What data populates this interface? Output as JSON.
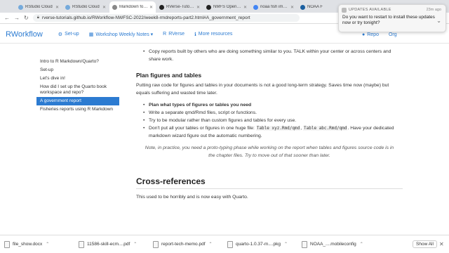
{
  "browser": {
    "tabs": [
      {
        "label": "RStudio Cloud",
        "color": "#75aadb",
        "active": false
      },
      {
        "label": "RStudio Cloud",
        "color": "#75aadb",
        "active": false
      },
      {
        "label": "Markdown for R",
        "color": "#888888",
        "active": true
      },
      {
        "label": "RVerse-Tutorials/C",
        "color": "#222222",
        "active": false
      },
      {
        "label": "NMFS Open Science",
        "color": "#222222",
        "active": false
      },
      {
        "label": "noaa fish image - G",
        "color": "#4285f4",
        "active": false
      },
      {
        "label": "NOAA F",
        "color": "#1a5fa0",
        "active": false
      }
    ],
    "url": "rverse-tutorials.github.io/RWorkflow-NWFSC-2022/week8-rmdreports-part2.html#A_government_report"
  },
  "notification": {
    "title": "UPDATES AVAILABLE",
    "time": "23m ago",
    "body": "Do you want to restart to install these updates now or try tonight?"
  },
  "site": {
    "brand": "RWorkflow",
    "links": [
      {
        "icon": "gear-icon",
        "glyph": "⚙",
        "label": "Set-up"
      },
      {
        "icon": "calendar-icon",
        "glyph": "▦",
        "label": "Workshop Weekly Notes ▾"
      },
      {
        "icon": "r-icon",
        "glyph": "R",
        "label": "RVerse"
      },
      {
        "icon": "info-icon",
        "glyph": "ℹ",
        "label": "More resources"
      }
    ],
    "right_links": [
      {
        "icon": "github-icon",
        "glyph": "●",
        "label": "Repo"
      },
      {
        "icon": "",
        "glyph": "",
        "label": "Org"
      }
    ]
  },
  "toc": {
    "items": [
      {
        "label": "Intro to R Markdown/Quarto?",
        "active": false
      },
      {
        "label": "Set-up",
        "active": false
      },
      {
        "label": "Let's dive in!",
        "active": false
      },
      {
        "label": "How did I set up the Quarto book workspace and repo?",
        "active": false
      },
      {
        "label": "A government report",
        "active": true
      },
      {
        "label": "Fisheries reports using R Markdown",
        "active": false
      }
    ]
  },
  "content": {
    "top_bullet_1": "Copy reports built by others who are doing something similar to you. TALK within your center or across centers and share work.",
    "heading_plan": "Plan figures and tables",
    "para_plan": "Putting raw code for figures and tables in your documents is not a good long-term strategy. Saves time now (maybe) but equals suffering and wasted time later.",
    "bullets": [
      {
        "bold": "Plan what types of figures or tables you need",
        "pre": "",
        "code1": "",
        "mid": "",
        "code2": "",
        "post": ""
      },
      {
        "bold": "",
        "pre": "Write a separate qmd/Rmd files, script or functions.",
        "code1": "",
        "mid": "",
        "code2": "",
        "post": ""
      },
      {
        "bold": "",
        "pre": "Try to be modular rather than custom figures and tables for every use.",
        "code1": "",
        "mid": "",
        "code2": "",
        "post": ""
      },
      {
        "bold": "",
        "pre": "Don't put all your tables or figures in one huge file: ",
        "code1": "Table xyz.Rmd/qmd",
        "mid": ", ",
        "code2": "Table abc.Rmd/qmd",
        "post": ". Have your dedicated markdown wizard figure out the automatic numbering."
      }
    ],
    "note": "Note, in practice, you need a proto-typing phase while working on the report when tables and figures source code is in the chapter files. Try to move out of that sooner than later.",
    "heading_cross": "Cross-references",
    "para_cross": "This used to be horribly and is now easy with Quarto."
  },
  "downloads": {
    "items": [
      {
        "name": "file_show.docx",
        "type": "file-icon"
      },
      {
        "name": "11586-skill-ecm....pdf",
        "type": "file-icon"
      },
      {
        "name": "report-tech-memo.pdf",
        "type": "file-icon"
      },
      {
        "name": "quarto-1.0.37-m....pkg",
        "type": "file-icon"
      },
      {
        "name": "NOAA_....mobileconfig",
        "type": "file-icon"
      }
    ],
    "show_all": "Show All"
  }
}
